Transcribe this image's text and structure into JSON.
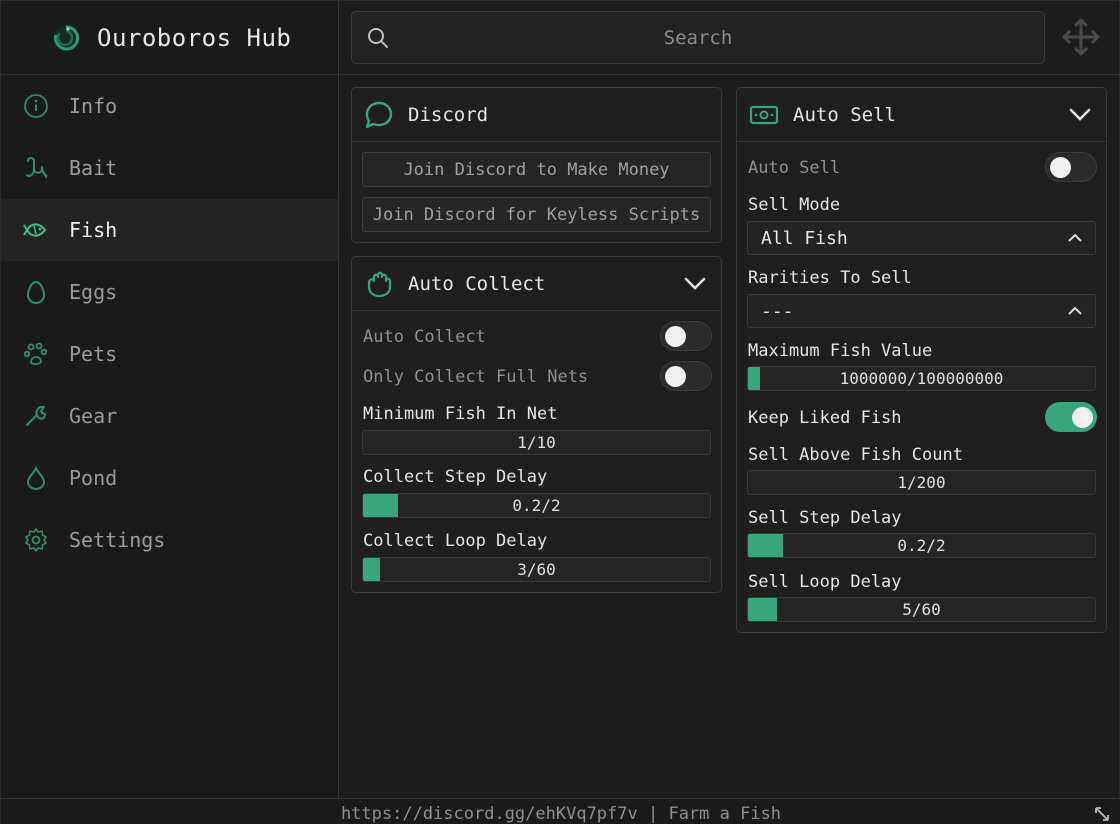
{
  "app": {
    "title": "Ouroboros Hub"
  },
  "nav": {
    "items": [
      {
        "label": "Info",
        "icon": "info-icon"
      },
      {
        "label": "Bait",
        "icon": "worm-icon"
      },
      {
        "label": "Fish",
        "icon": "fish-icon",
        "active": true
      },
      {
        "label": "Eggs",
        "icon": "egg-icon"
      },
      {
        "label": "Pets",
        "icon": "paw-icon"
      },
      {
        "label": "Gear",
        "icon": "wrench-icon"
      },
      {
        "label": "Pond",
        "icon": "droplet-icon"
      },
      {
        "label": "Settings",
        "icon": "gear-icon"
      }
    ]
  },
  "search": {
    "placeholder": "Search"
  },
  "discord": {
    "title": "Discord",
    "buttons": [
      "Join Discord to Make Money",
      "Join Discord for Keyless Scripts"
    ]
  },
  "auto_collect": {
    "title": "Auto Collect",
    "toggle_auto": {
      "label": "Auto Collect",
      "on": false
    },
    "toggle_full": {
      "label": "Only Collect Full Nets",
      "on": false
    },
    "min_fish": {
      "label": "Minimum Fish In Net",
      "value": "1/10",
      "fraction": 0.0
    },
    "step_delay": {
      "label": "Collect Step Delay",
      "value": "0.2/2",
      "fraction": 0.1
    },
    "loop_delay": {
      "label": "Collect Loop Delay",
      "value": "3/60",
      "fraction": 0.05
    }
  },
  "auto_sell": {
    "title": "Auto Sell",
    "toggle_auto": {
      "label": "Auto Sell",
      "on": false
    },
    "sell_mode": {
      "label": "Sell Mode",
      "value": "All Fish"
    },
    "rarities": {
      "label": "Rarities To Sell",
      "value": "---"
    },
    "max_value": {
      "label": "Maximum Fish Value",
      "value": "1000000/100000000",
      "fraction": 0.01
    },
    "keep_liked": {
      "label": "Keep Liked Fish",
      "on": true
    },
    "sell_above": {
      "label": "Sell Above Fish Count",
      "value": "1/200",
      "fraction": 0.0
    },
    "step_delay": {
      "label": "Sell Step Delay",
      "value": "0.2/2",
      "fraction": 0.1
    },
    "loop_delay": {
      "label": "Sell Loop Delay",
      "value": "5/60",
      "fraction": 0.083
    }
  },
  "footer": {
    "text": "https://discord.gg/ehKVq7pf7v | Farm a Fish"
  },
  "colors": {
    "accent": "#3aa57c",
    "background": "#1c1c1c"
  }
}
